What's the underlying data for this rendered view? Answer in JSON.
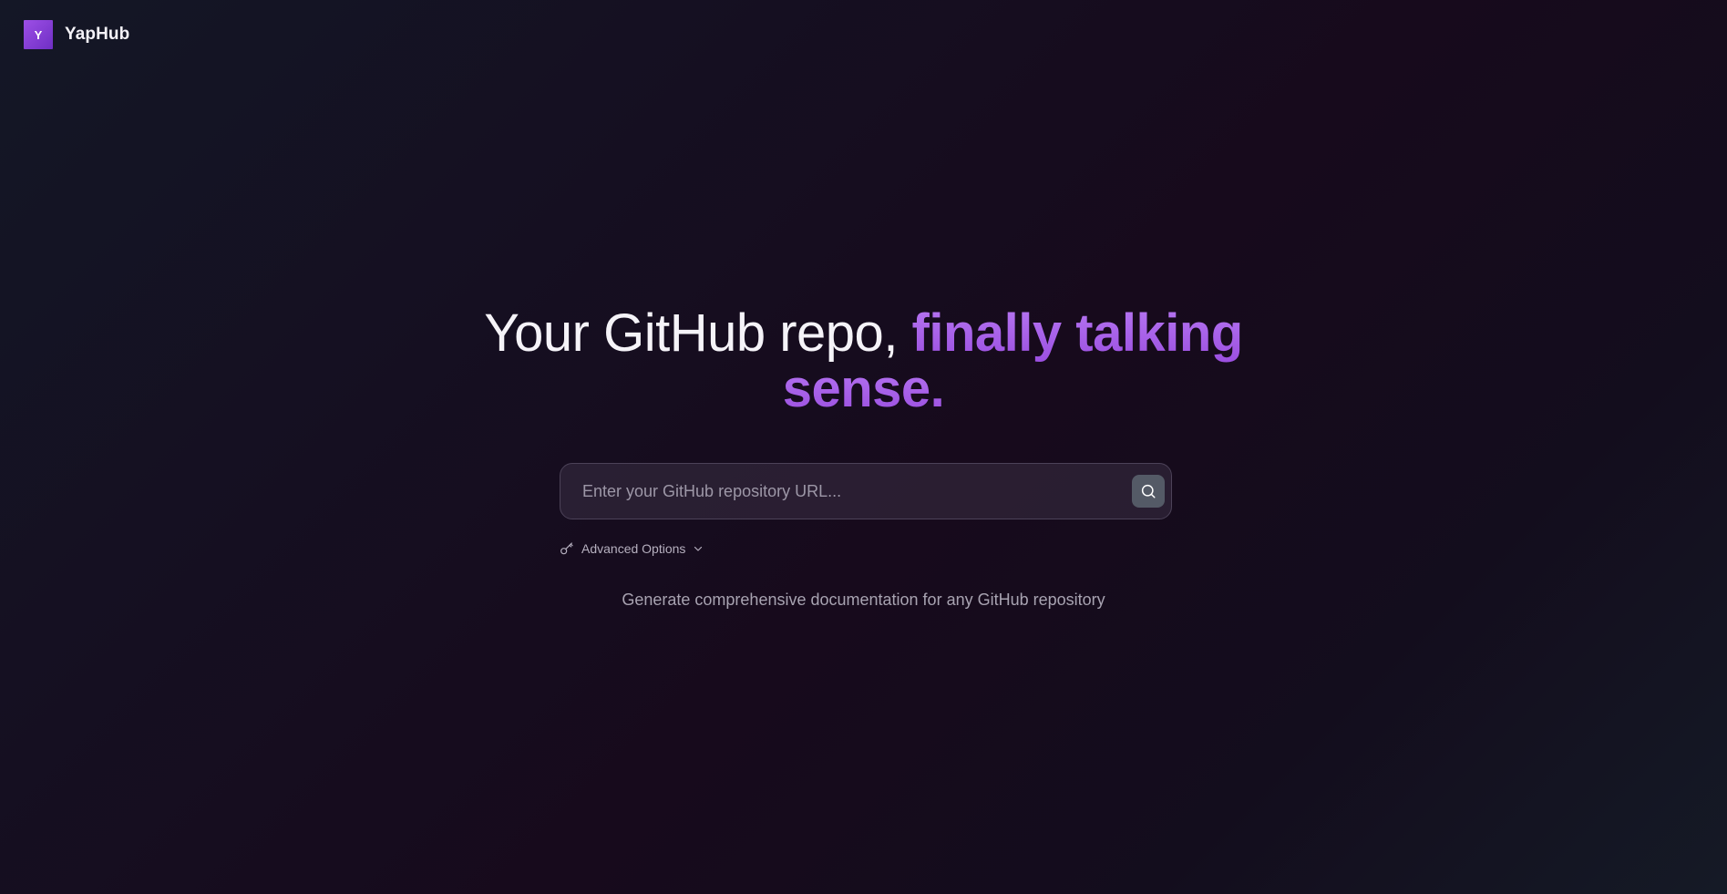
{
  "brand": {
    "logo_letter": "Y",
    "name": "YapHub"
  },
  "hero": {
    "title_plain": "Your GitHub repo, ",
    "title_accent_line1": "finally talking",
    "title_accent_line2": "sense."
  },
  "search": {
    "placeholder": "Enter your GitHub repository URL...",
    "value": "",
    "button_icon": "search-icon"
  },
  "advanced_options": {
    "label": "Advanced Options",
    "icon": "key-icon",
    "toggle_icon": "chevron-down-icon"
  },
  "subtitle": "Generate comprehensive documentation for any GitHub repository",
  "colors": {
    "accent": "#b26cf0",
    "logo": "#8b3fdc",
    "background": "#140f20"
  }
}
